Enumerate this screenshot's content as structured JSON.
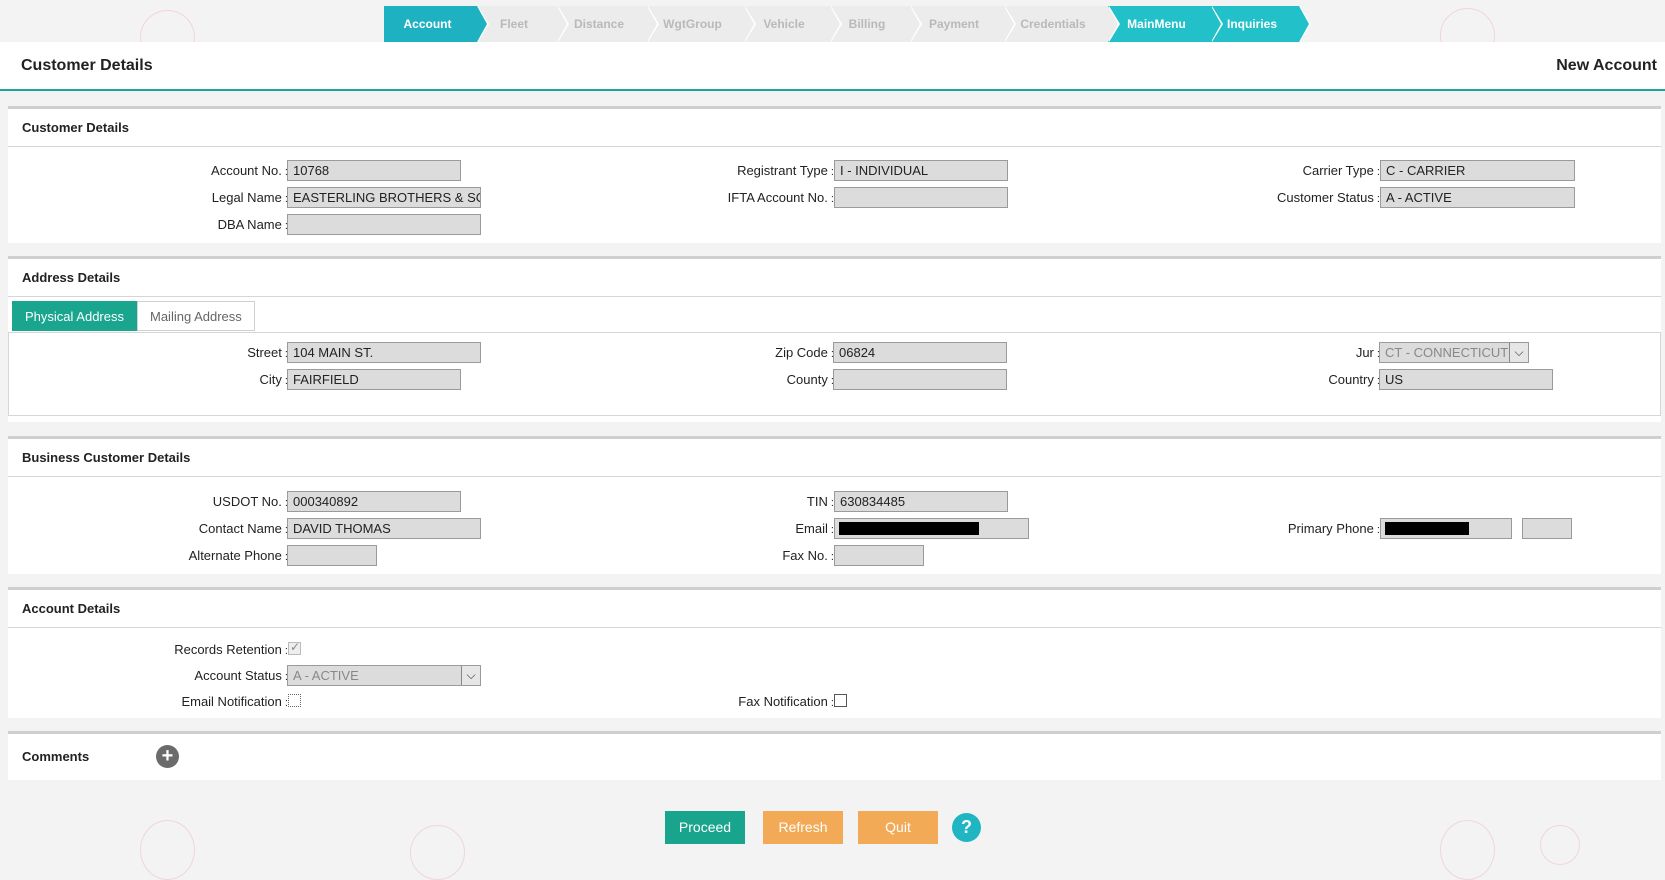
{
  "wizard": {
    "steps": [
      {
        "label": "Account",
        "state": "active"
      },
      {
        "label": "Fleet",
        "state": "disabled"
      },
      {
        "label": "Distance",
        "state": "disabled"
      },
      {
        "label": "WgtGroup",
        "state": "disabled"
      },
      {
        "label": "Vehicle",
        "state": "disabled"
      },
      {
        "label": "Billing",
        "state": "disabled"
      },
      {
        "label": "Payment",
        "state": "disabled"
      },
      {
        "label": "Credentials",
        "state": "disabled"
      },
      {
        "label": "MainMenu",
        "state": "link"
      },
      {
        "label": "Inquiries",
        "state": "link"
      }
    ]
  },
  "header": {
    "title": "Customer Details",
    "mode": "New Account"
  },
  "customer": {
    "heading": "Customer Details",
    "account_no_label": "Account No.",
    "account_no": "10768",
    "legal_name_label": "Legal Name",
    "legal_name": "EASTERLING BROTHERS & SON",
    "dba_name_label": "DBA Name",
    "dba_name": "",
    "registrant_type_label": "Registrant Type",
    "registrant_type": "I - INDIVIDUAL",
    "ifta_label": "IFTA Account No.",
    "ifta": "",
    "carrier_type_label": "Carrier Type",
    "carrier_type": "C - CARRIER",
    "customer_status_label": "Customer Status",
    "customer_status": "A - ACTIVE"
  },
  "address": {
    "heading": "Address Details",
    "tabs": [
      "Physical Address",
      "Mailing Address"
    ],
    "street_label": "Street",
    "street": "104 MAIN ST.",
    "city_label": "City",
    "city": "FAIRFIELD",
    "zip_label": "Zip Code",
    "zip": "06824",
    "county_label": "County",
    "county": "",
    "jur_label": "Jur",
    "jur": "CT - CONNECTICUT",
    "country_label": "Country",
    "country": "US"
  },
  "business": {
    "heading": "Business Customer Details",
    "usdot_label": "USDOT No.",
    "usdot": "000340892",
    "contact_label": "Contact Name",
    "contact": "DAVID THOMAS",
    "alt_phone_label": "Alternate Phone",
    "alt_phone": "",
    "tin_label": "TIN",
    "tin": "630834485",
    "email_label": "Email",
    "fax_label": "Fax No.",
    "fax": "",
    "primary_phone_label": "Primary Phone"
  },
  "account": {
    "heading": "Account Details",
    "records_label": "Records Retention",
    "status_label": "Account Status",
    "status": "A - ACTIVE",
    "email_notif_label": "Email Notification",
    "fax_notif_label": "Fax Notification"
  },
  "comments": {
    "heading": "Comments"
  },
  "buttons": {
    "proceed": "Proceed",
    "refresh": "Refresh",
    "quit": "Quit",
    "help": "?"
  },
  "colors": {
    "teal": "#1aa58f",
    "wizard_active": "#1eb1c2",
    "orange": "#f3aa56"
  }
}
